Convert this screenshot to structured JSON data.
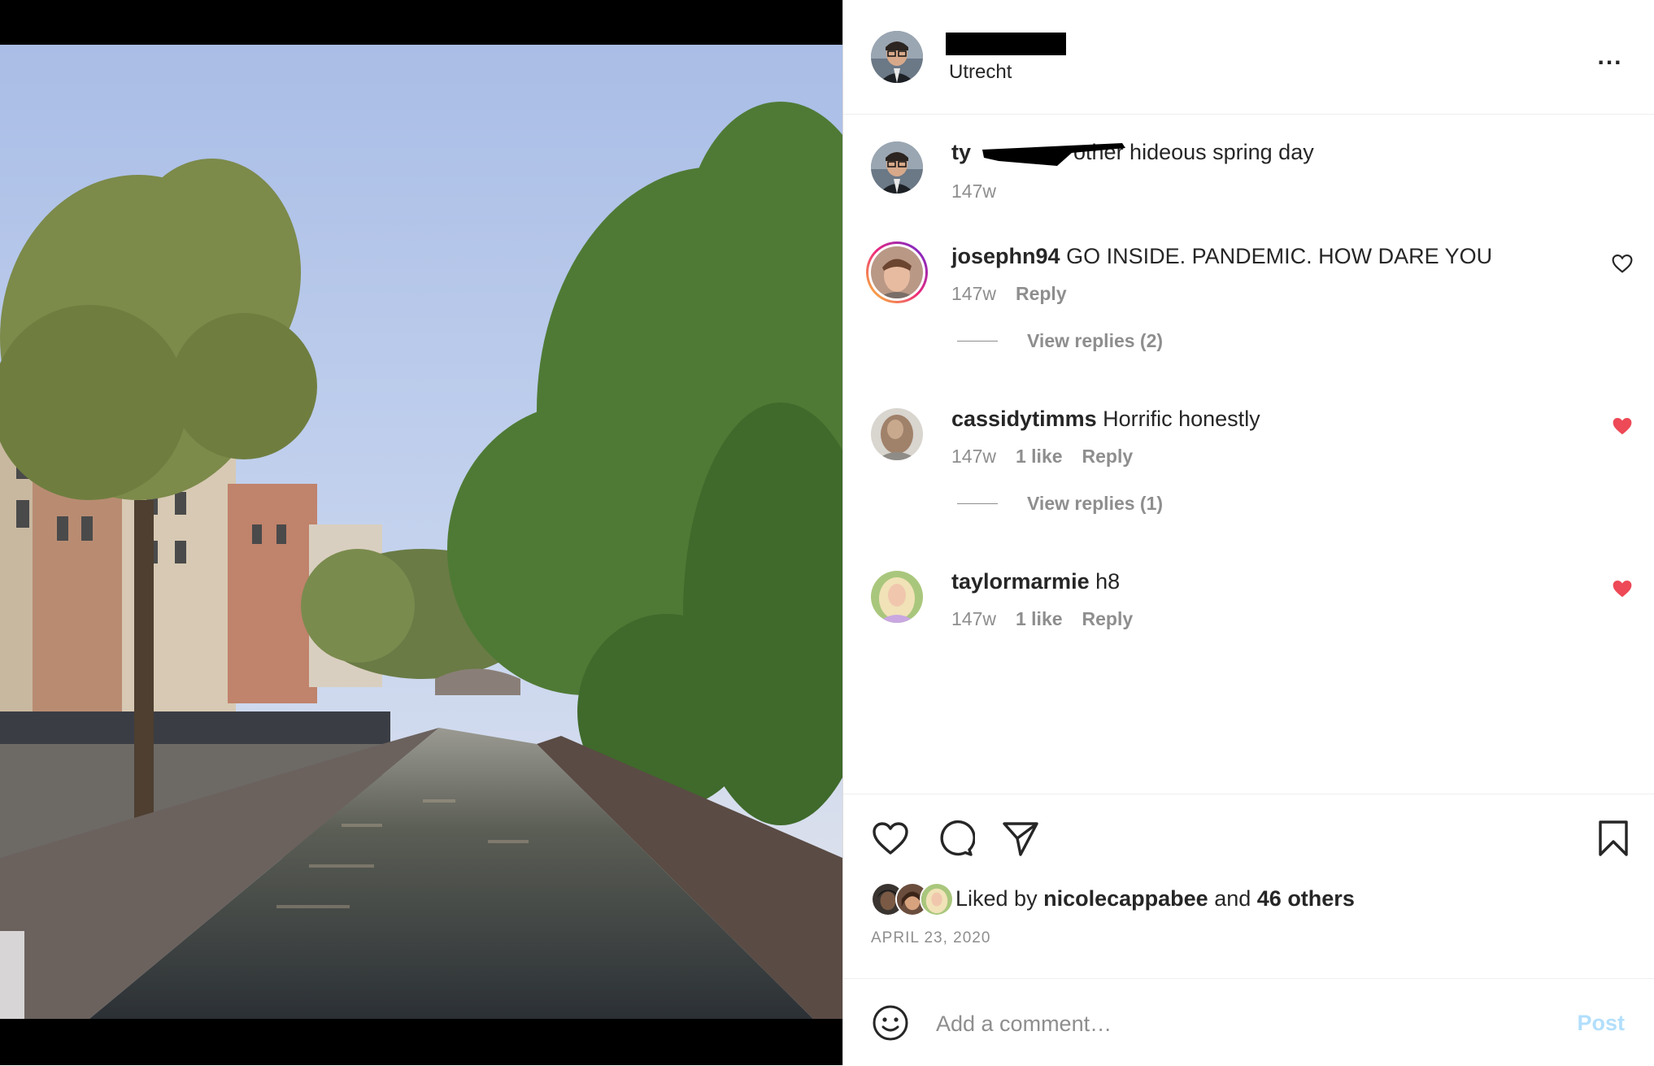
{
  "post": {
    "location": "Utrecht",
    "menu_label": "...",
    "photo_alt": "Photo"
  },
  "caption": {
    "username_visible": "ty",
    "text": "other hideous spring day",
    "age": "147w"
  },
  "comments": [
    {
      "username": "josephn94",
      "text": "GO INSIDE. PANDEMIC. HOW DARE YOU",
      "age": "147w",
      "likes": "",
      "reply_label": "Reply",
      "liked": false,
      "view_replies": "View replies (2)"
    },
    {
      "username": "cassidytimms",
      "text": "Horrific honestly",
      "age": "147w",
      "likes": "1 like",
      "reply_label": "Reply",
      "liked": true,
      "view_replies": "View replies (1)"
    },
    {
      "username": "taylormarmie",
      "text": "h8",
      "age": "147w",
      "likes": "1 like",
      "reply_label": "Reply",
      "liked": true,
      "view_replies": ""
    }
  ],
  "likes_summary": {
    "prefix": "Liked by",
    "user": "nicolecappabee",
    "joiner": "and",
    "others": "46 others"
  },
  "date": "APRIL 23, 2020",
  "composer": {
    "placeholder": "Add a comment…",
    "post_label": "Post"
  },
  "colors": {
    "liked_heart": "#ed4956",
    "meta_text": "#8e8e8e",
    "post_button": "#b2dffc",
    "story_ring": "#d6249f"
  },
  "icons": {
    "header_menu": "more-horizontal-icon",
    "like": "heart-icon",
    "comment": "comment-icon",
    "share": "paper-plane-icon",
    "save": "bookmark-icon",
    "emoji": "smiley-icon"
  }
}
